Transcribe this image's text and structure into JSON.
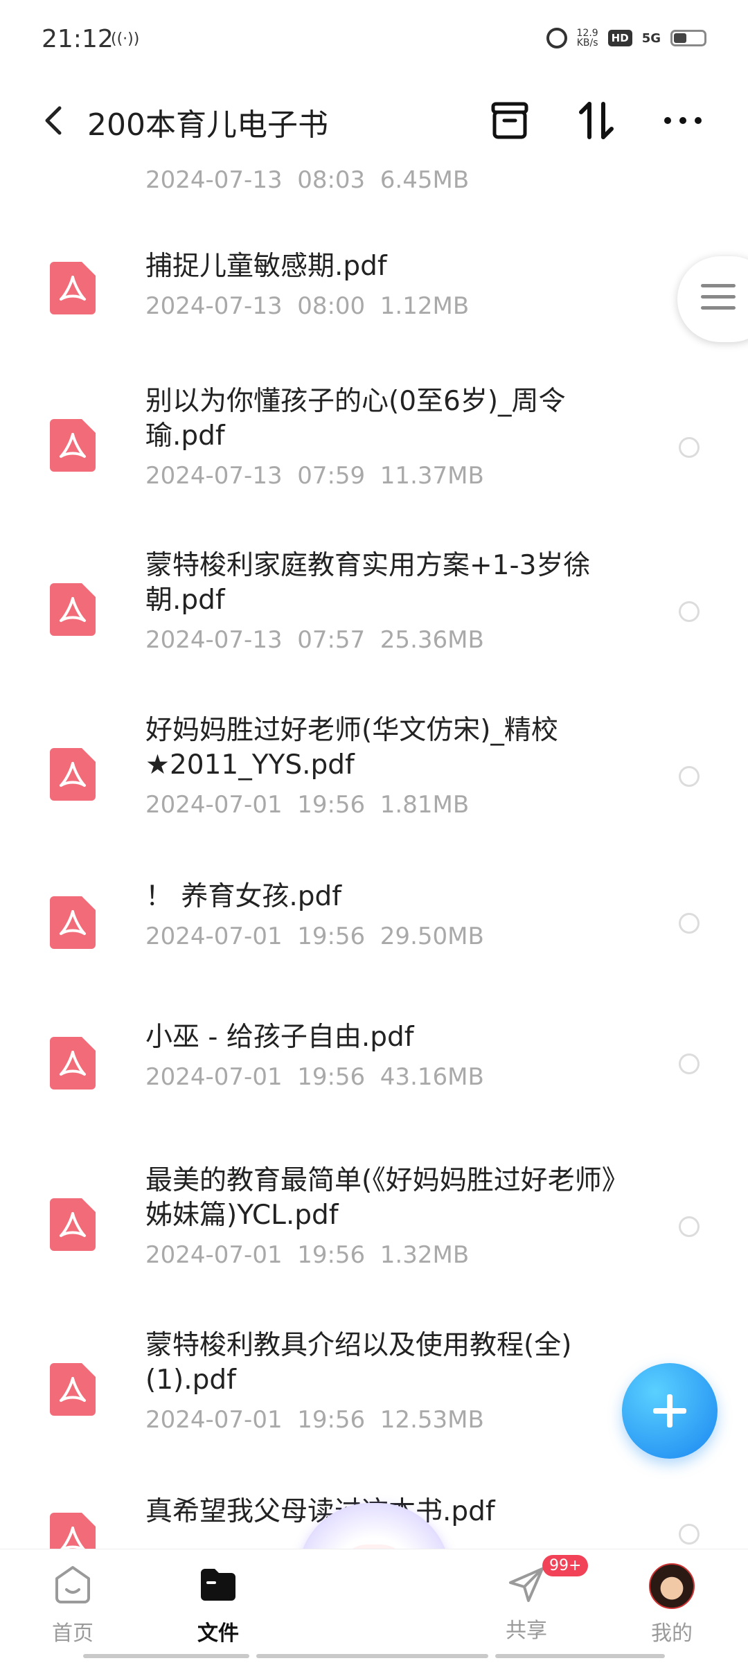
{
  "status_bar": {
    "time": "21:12",
    "hotspot": "((·))",
    "net_speed_value": "12.9",
    "net_speed_unit": "KB/s",
    "hd": "HD",
    "network": "5G"
  },
  "header": {
    "title": "200本育儿电子书"
  },
  "files": [
    {
      "name": "",
      "meta": "2024-07-13  08:03  6.45MB"
    },
    {
      "name": "捕捉儿童敏感期.pdf",
      "meta": "2024-07-13  08:00  1.12MB"
    },
    {
      "name": "别以为你懂孩子的心(0至6岁)_周令瑜.pdf",
      "meta": "2024-07-13  07:59  11.37MB"
    },
    {
      "name": "蒙特梭利家庭教育实用方案+1-3岁徐朝.pdf",
      "meta": "2024-07-13  07:57  25.36MB"
    },
    {
      "name": "好妈妈胜过好老师(华文仿宋)_精校★2011_YYS.pdf",
      "meta": "2024-07-01  19:56  1.81MB"
    },
    {
      "name": "！ 养育女孩.pdf",
      "meta": "2024-07-01  19:56  29.50MB"
    },
    {
      "name": "小巫 - 给孩子自由.pdf",
      "meta": "2024-07-01  19:56  43.16MB"
    },
    {
      "name": "最美的教育最简单(《好妈妈胜过好老师》姊妹篇)YCL.pdf",
      "meta": "2024-07-01  19:56  1.32MB"
    },
    {
      "name": "蒙特梭利教具介绍以及使用教程(全)(1).pdf",
      "meta": "2024-07-01  19:56  12.53MB"
    },
    {
      "name": "真希望我父母读过这本书.pdf",
      "meta": ""
    }
  ],
  "tabs": [
    {
      "label": "首页"
    },
    {
      "label": "文件"
    },
    {
      "label": "共享",
      "badge": "99+"
    },
    {
      "label": "我的"
    }
  ],
  "colors": {
    "pdf_icon": "#f26b78",
    "fab": "#1a86f0",
    "badge": "#f24257"
  }
}
